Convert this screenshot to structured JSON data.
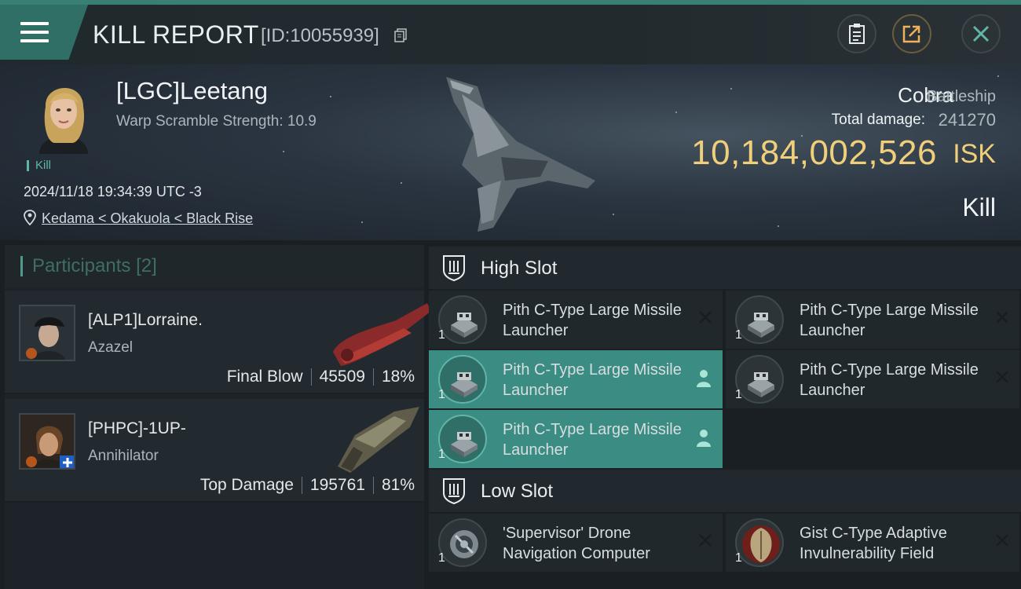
{
  "header": {
    "title": "KILL REPORT",
    "id_text": "[ID:10055939]"
  },
  "victim": {
    "name": "[LGC]Leetang",
    "warp_scramble": "Warp Scramble Strength: 10.9",
    "kill_tag": "Kill",
    "datetime": "2024/11/18 19:34:39 UTC -3",
    "location": "Kedama < Okakuola < Black Rise",
    "ship_name": "Cobra",
    "ship_class": "Battleship",
    "total_damage_label": "Total damage:",
    "total_damage": "241270",
    "isk_value": "10,184,002,526",
    "isk_unit": "ISK",
    "result": "Kill"
  },
  "participants": {
    "title": "Participants",
    "count": "[2]",
    "rows": [
      {
        "name": "[ALP1]Lorraine.",
        "ship": "Azazel",
        "role": "Final Blow",
        "damage": "45509",
        "percent": "18%"
      },
      {
        "name": "[PHPC]-1UP-",
        "ship": "Annihilator",
        "role": "Top Damage",
        "damage": "195761",
        "percent": "81%"
      }
    ]
  },
  "slots": {
    "high": {
      "title": "High Slot",
      "items": [
        {
          "name": "Pith C-Type Large Missile Launcher",
          "qty": "1",
          "state": "destroyed"
        },
        {
          "name": "Pith C-Type Large Missile Launcher",
          "qty": "1",
          "state": "destroyed"
        },
        {
          "name": "Pith C-Type Large Missile Launcher",
          "qty": "1",
          "state": "dropped"
        },
        {
          "name": "Pith C-Type Large Missile Launcher",
          "qty": "1",
          "state": "destroyed"
        },
        {
          "name": "Pith C-Type Large Missile Launcher",
          "qty": "1",
          "state": "dropped"
        }
      ]
    },
    "low": {
      "title": "Low Slot",
      "items": [
        {
          "name": "'Supervisor' Drone Navigation Computer",
          "qty": "1",
          "state": "destroyed"
        },
        {
          "name": "Gist C-Type Adaptive Invulnerability Field",
          "qty": "1",
          "state": "destroyed"
        }
      ]
    }
  },
  "colors": {
    "accent": "#3b8c82",
    "isk": "#f1cf7a",
    "panel": "#21282c"
  }
}
